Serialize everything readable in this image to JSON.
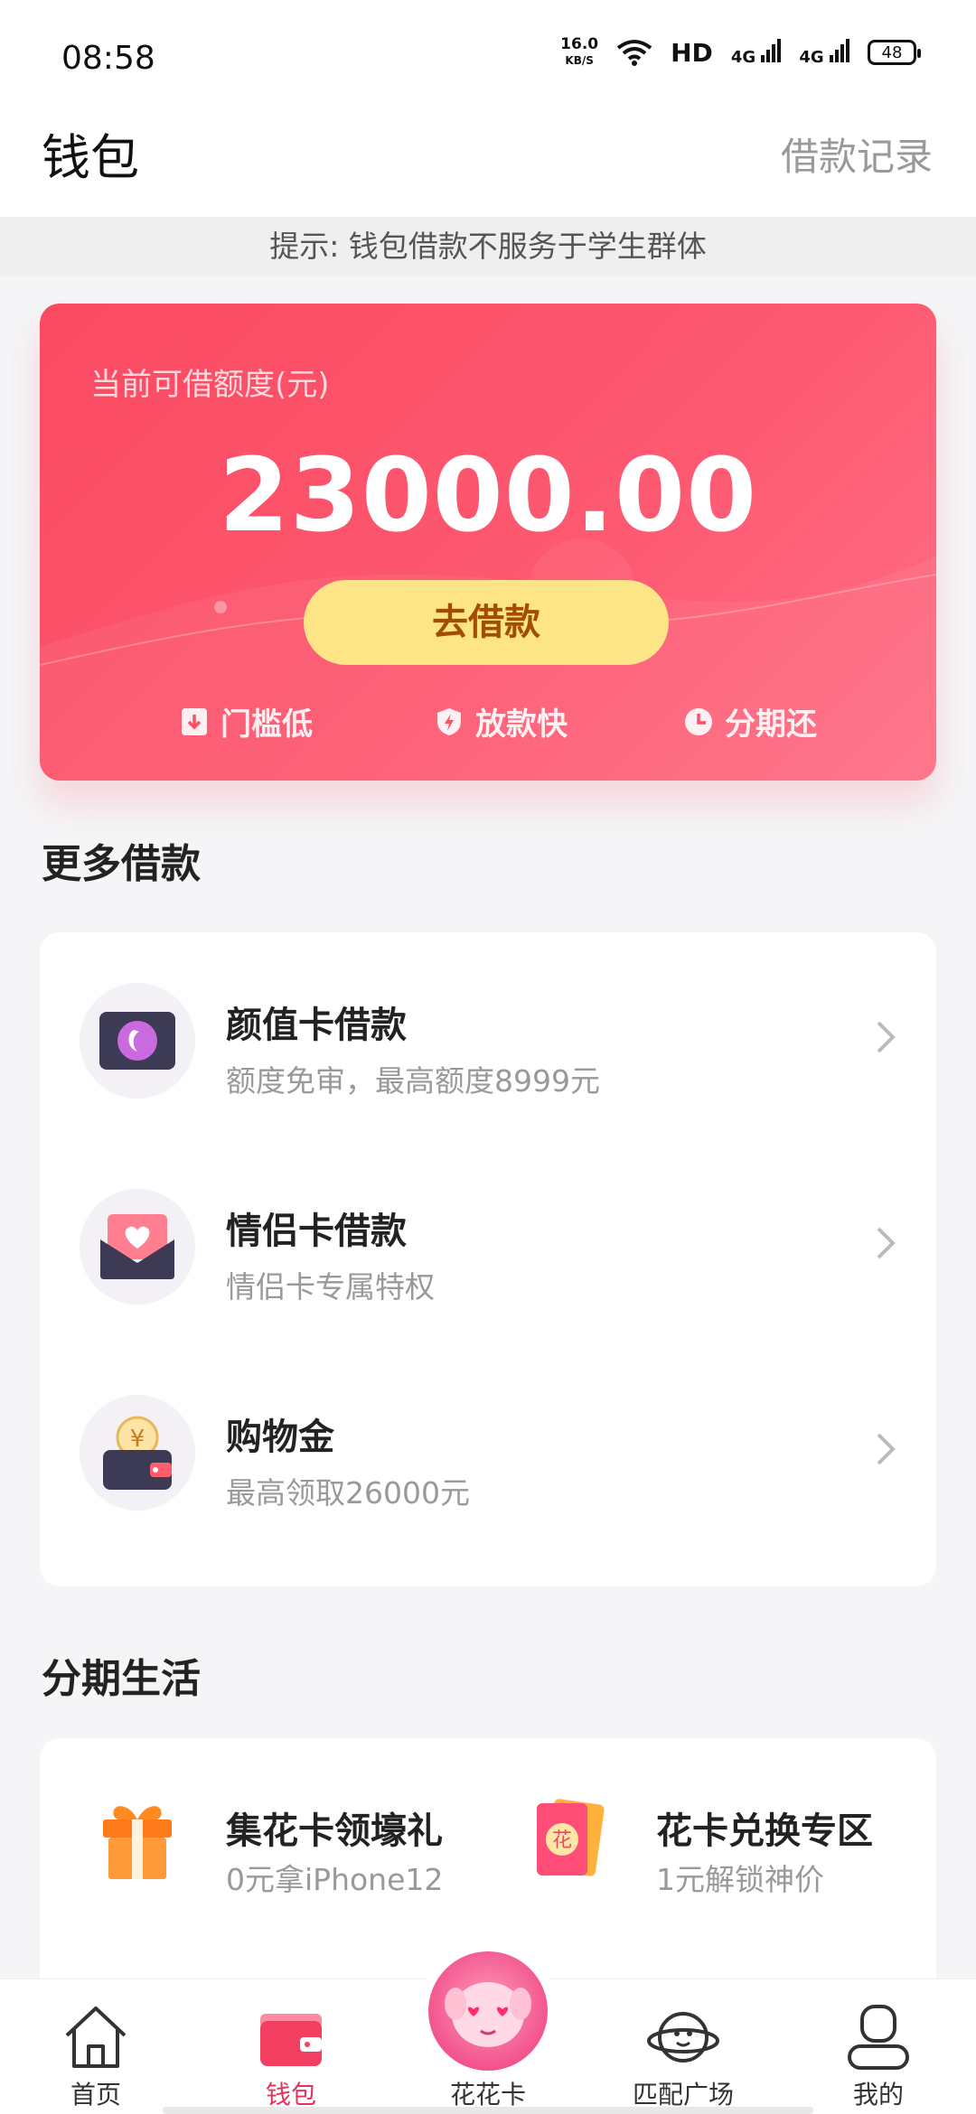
{
  "status_bar": {
    "time": "08:58",
    "net_speed_value": "16.0",
    "net_speed_unit": "KB/S",
    "hd": "HD",
    "signal_1": "4G",
    "signal_2": "4G",
    "battery": "48"
  },
  "header": {
    "title": "钱包",
    "record_link": "借款记录"
  },
  "notice": "提示: 钱包借款不服务于学生群体",
  "loan_card": {
    "label": "当前可借额度(元)",
    "amount": "23000.00",
    "button": "去借款",
    "features": [
      "门槛低",
      "放款快",
      "分期还"
    ]
  },
  "more_loans": {
    "title": "更多借款",
    "items": [
      {
        "title": "颜值卡借款",
        "subtitle": "额度免审，最高额度8999元",
        "icon": "face-card-icon"
      },
      {
        "title": "情侣卡借款",
        "subtitle": "情侣卡专属特权",
        "icon": "couple-card-icon"
      },
      {
        "title": "购物金",
        "subtitle": "最高领取26000元",
        "icon": "shopping-wallet-icon"
      }
    ]
  },
  "installment_life": {
    "title": "分期生活",
    "items": [
      {
        "title": "集花卡领壕礼",
        "subtitle": "0元拿iPhone12",
        "icon": "gift-icon"
      },
      {
        "title": "花卡兑换专区",
        "subtitle": "1元解锁神价",
        "icon": "flower-card-icon",
        "badge": "花"
      }
    ]
  },
  "tabbar": {
    "items": [
      {
        "label": "首页",
        "icon": "home-icon"
      },
      {
        "label": "钱包",
        "icon": "wallet-icon",
        "active": true
      },
      {
        "label": "花花卡",
        "icon": "mascot-icon"
      },
      {
        "label": "匹配广场",
        "icon": "planet-icon"
      },
      {
        "label": "我的",
        "icon": "profile-icon"
      }
    ]
  },
  "colors": {
    "accent": "#fa4a61",
    "button_yellow": "#fde487",
    "active_tab": "#e3335a"
  }
}
